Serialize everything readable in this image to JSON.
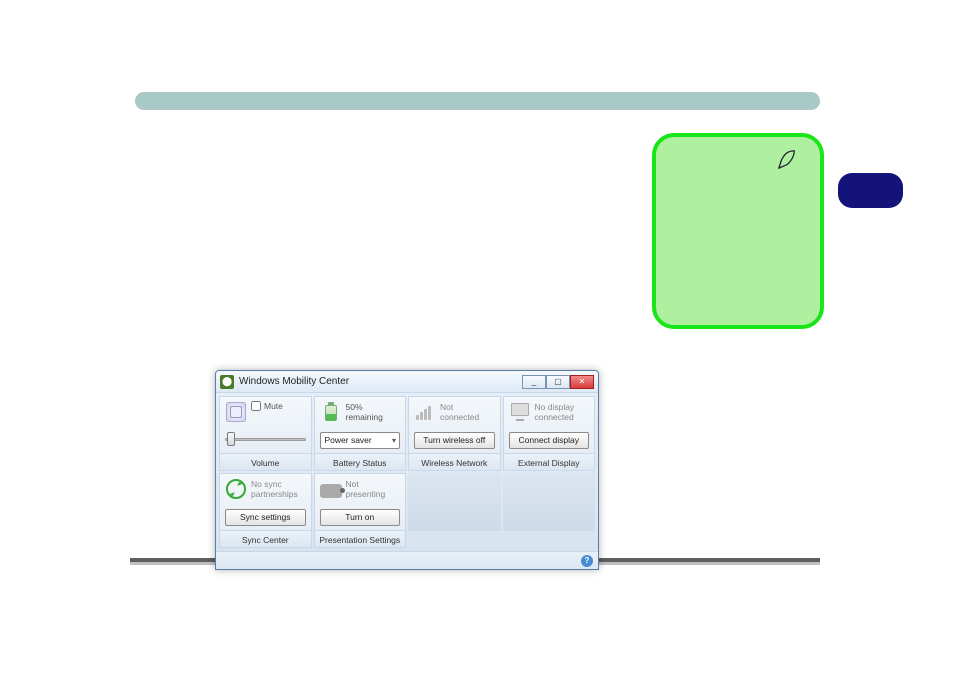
{
  "window": {
    "title": "Windows Mobility Center",
    "min": "_",
    "max": "▢",
    "close": "✕",
    "help": "?"
  },
  "tiles": {
    "volume": {
      "mute_label": "Mute",
      "label": "Volume"
    },
    "battery": {
      "status": "50% remaining",
      "select": "Power saver",
      "label": "Battery Status"
    },
    "wireless": {
      "status": "Not connected",
      "button": "Turn wireless off",
      "label": "Wireless Network"
    },
    "external": {
      "status": "No display connected",
      "button": "Connect display",
      "label": "External Display"
    },
    "sync": {
      "status": "No sync partnerships",
      "button": "Sync settings",
      "label": "Sync Center"
    },
    "presentation": {
      "status": "Not presenting",
      "button": "Turn on",
      "label": "Presentation Settings"
    }
  }
}
